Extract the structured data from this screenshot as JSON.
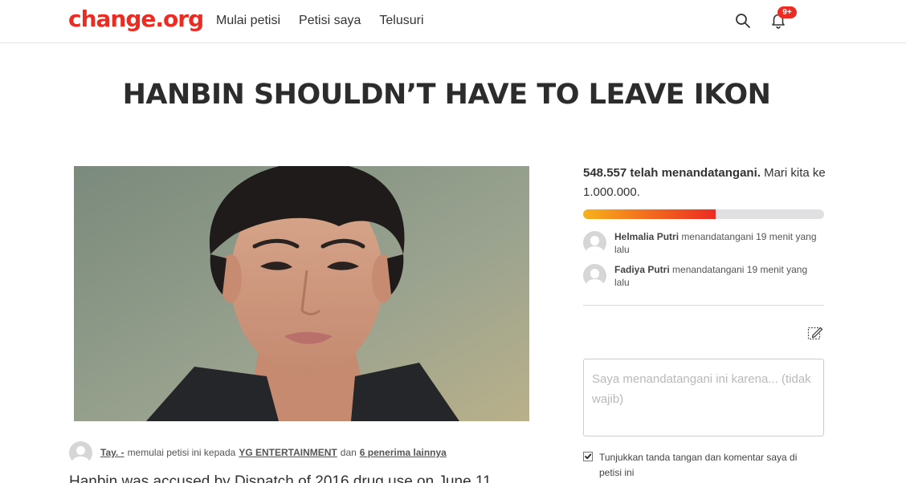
{
  "header": {
    "logo": "change.org",
    "nav": [
      "Mulai petisi",
      "Petisi saya",
      "Telusuri"
    ],
    "notification_badge": "9+",
    "brand_color": "#ec2c22"
  },
  "petition": {
    "title": "HANBIN SHOULDN’T HAVE TO LEAVE IKON",
    "starter_name": "Tay. -",
    "starter_text": "memulai petisi ini kepada",
    "target": "YG ENTERTAINMENT",
    "and_text": "dan",
    "others": "6 penerima lainnya",
    "story_start": "Hanbin was accused by Dispatch of 2016 drug use on June 11"
  },
  "signatures": {
    "count_bold": "548.557 telah menandatangani.",
    "goal_text": "Mari kita ke 1.000.000.",
    "progress_fraction": 0.548557
  },
  "recent_signers": [
    {
      "name": "Helmalia Putri",
      "action": "menandatangani 19 menit yang lalu"
    },
    {
      "name": "Fadiya Putri",
      "action": "menandatangani 19 menit yang lalu"
    }
  ],
  "form": {
    "comment_placeholder": "Saya menandatangani ini karena... (tidak wajib)",
    "show_signature_label": "Tunjukkan tanda tangan dan komentar saya di petisi ini",
    "show_signature_checked": true
  },
  "icons": {
    "search": "search-icon",
    "bell": "bell-icon",
    "edit": "edit-icon",
    "avatar": "avatar-placeholder-icon"
  }
}
